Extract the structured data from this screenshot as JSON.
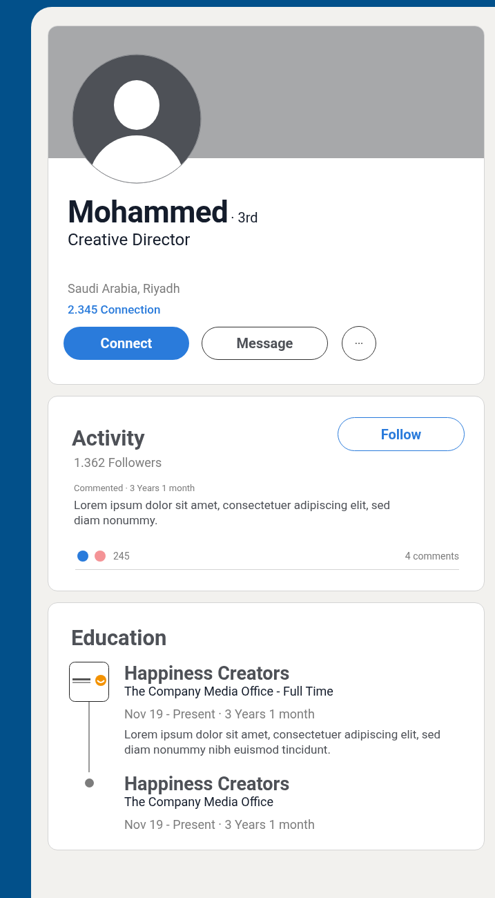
{
  "profile": {
    "name": "Mohammed",
    "degree": "· 3rd",
    "headline": "Creative Director",
    "location": "Saudi Arabia, Riyadh",
    "connections": "2.345 Connection",
    "buttons": [
      {
        "kind": "primary",
        "label": "Connect"
      },
      {
        "kind": "outline",
        "label": "Message"
      },
      {
        "kind": "more",
        "label": "···"
      }
    ]
  },
  "activity": {
    "title": "Activity",
    "follow": "Follow",
    "followers": "1.362 Followers",
    "meta": "Commented · 3 Years 1 month",
    "text": "Lorem ipsum dolor sit amet, consectetuer adipiscing elit, sed diam nonummy.",
    "reactions": [
      {
        "color": "#2a7bdb"
      },
      {
        "color": "#f49396"
      }
    ],
    "reaction_count": "245",
    "comments": "4 comments"
  },
  "education": {
    "title": "Education",
    "entries": [
      {
        "kind": "logo",
        "school": "Happiness Creators",
        "subtitle": "The Company Media Office - Full Time",
        "dates": "Nov 19 - Present · 3 Years 1 month",
        "description": "Lorem ipsum dolor sit amet, consectetuer adipiscing elit, sed diam nonummy nibh euismod tincidunt."
      },
      {
        "kind": "dot",
        "school": "Happiness Creators",
        "subtitle": "The Company Media Office",
        "dates": "Nov 19 - Present · 3 Years 1 month"
      }
    ]
  }
}
